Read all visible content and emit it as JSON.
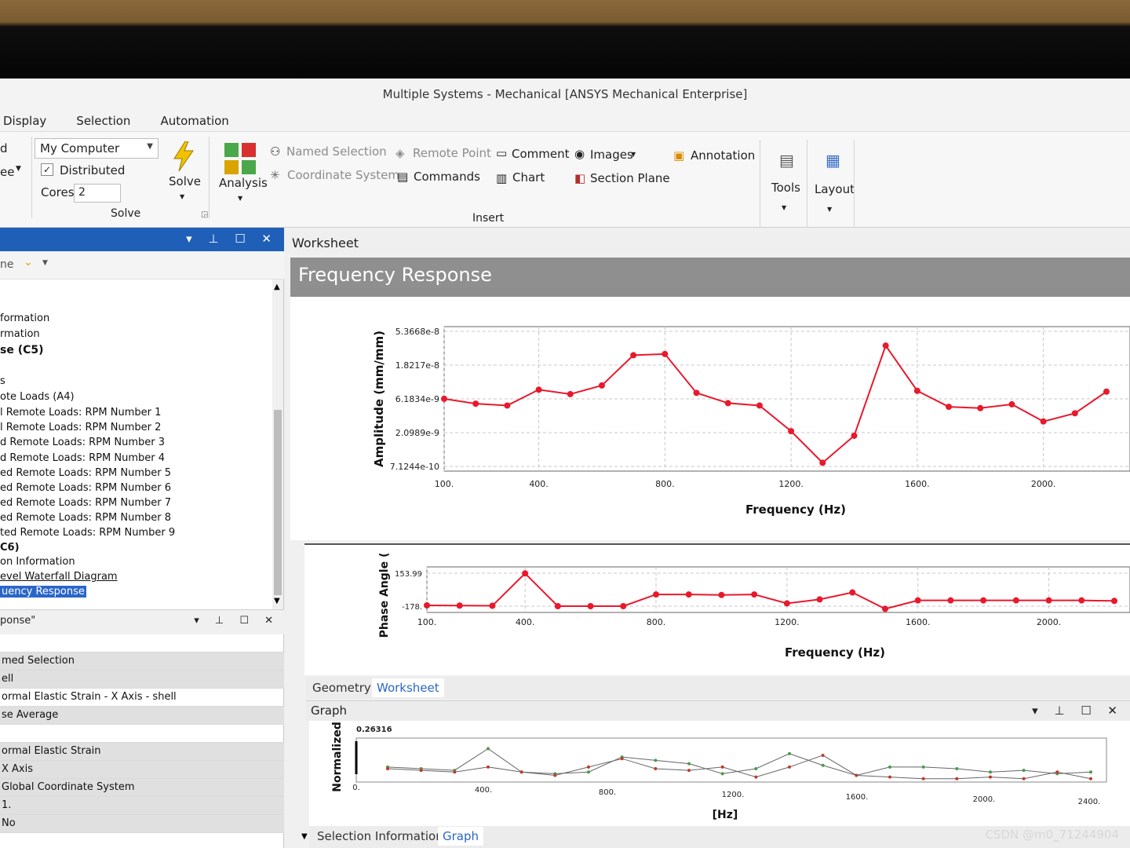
{
  "window": {
    "title": "Multiple Systems - Mechanical [ANSYS Mechanical Enterprise]"
  },
  "menu": [
    "Display",
    "Selection",
    "Automation"
  ],
  "ribbon": {
    "left_partial": [
      "d",
      "ee"
    ],
    "solve": {
      "computer": "My Computer",
      "distributed": "Distributed",
      "cores_label": "Cores",
      "cores_value": "2",
      "solve_label": "Solve",
      "group_label": "Solve"
    },
    "analysis_label": "Analysis",
    "insert": {
      "named_selection": "Named Selection",
      "coordinate_system": "Coordinate System",
      "remote_point": "Remote Point",
      "commands": "Commands",
      "comment": "Comment",
      "chart": "Chart",
      "images": "Images",
      "section_plane": "Section Plane",
      "annotation": "Annotation",
      "group_label": "Insert"
    },
    "tools_label": "Tools",
    "layout_label": "Layout"
  },
  "outline": {
    "toolbar_text": "ne",
    "items": [
      "formation",
      "rmation",
      "se (C5)",
      "s",
      "ote Loads (A4)",
      "l Remote Loads: RPM Number 1",
      "l Remote Loads: RPM Number 2",
      "d Remote Loads: RPM Number 3",
      "d Remote Loads: RPM Number 4",
      "ed Remote Loads: RPM Number 5",
      "ed Remote Loads: RPM Number 6",
      "ed Remote Loads: RPM Number 7",
      "ed Remote Loads: RPM Number 8",
      "ted Remote Loads: RPM Number 9",
      "C6)",
      "on Information",
      "evel Waterfall Diagram",
      "uency Response"
    ]
  },
  "details": {
    "header": "ponse\"",
    "rows": [
      "",
      "med Selection",
      "ell",
      "ormal Elastic Strain - X Axis - shell",
      "se Average",
      "",
      "ormal Elastic Strain",
      "X Axis",
      "Global Coordinate System",
      "1.",
      "No"
    ]
  },
  "worksheet": {
    "header": "Worksheet",
    "title": "Frequency Response"
  },
  "bottom_tabs": [
    "Geometry",
    "Worksheet"
  ],
  "graph": {
    "header": "Graph",
    "tabs": [
      "Selection Information",
      "Graph"
    ]
  },
  "colors": {
    "series": "#e8192c",
    "selection": "#2a66c8",
    "pane_header": "#1f5fb8"
  },
  "chart_data": [
    {
      "type": "line",
      "ylabel": "Amplitude (mm/mm)",
      "xlabel": "Frequency (Hz)",
      "x_ticks": [
        "100.",
        "400.",
        "800.",
        "1200.",
        "1600.",
        "2000."
      ],
      "y_ticks": [
        "5.3668e-8",
        "1.8217e-8",
        "6.1834e-9",
        "2.0989e-9",
        "7.1244e-10"
      ],
      "y_scale": "log",
      "x": [
        100,
        200,
        300,
        400,
        500,
        600,
        700,
        800,
        900,
        1000,
        1100,
        1200,
        1300,
        1400,
        1500,
        1600,
        1700,
        1800,
        1900,
        2000,
        2100,
        2200
      ],
      "y": [
        6.2e-09,
        5.3e-09,
        5e-09,
        8.3e-09,
        7.2e-09,
        9.5e-09,
        2.5e-08,
        2.6e-08,
        7.5e-09,
        5.4e-09,
        5e-09,
        2.2e-09,
        8e-10,
        1.9e-09,
        3.4e-08,
        8e-09,
        4.8e-09,
        4.6e-09,
        5.2e-09,
        3e-09,
        3.9e-09,
        7.8e-09
      ]
    },
    {
      "type": "line",
      "ylabel": "Phase Angle (",
      "xlabel": "Frequency (Hz)",
      "x_ticks": [
        "100.",
        "400.",
        "800.",
        "1200.",
        "1600.",
        "2000."
      ],
      "y_ticks": [
        "153.99",
        "-178."
      ],
      "ylim": [
        -178,
        153.99
      ],
      "x": [
        100,
        200,
        300,
        400,
        500,
        600,
        700,
        800,
        900,
        1000,
        1100,
        1200,
        1300,
        1400,
        1500,
        1600,
        1700,
        1800,
        1900,
        2000,
        2100,
        2200
      ],
      "y": [
        -170,
        -172,
        -174,
        152,
        -178,
        -178,
        -178,
        -60,
        -60,
        -65,
        -60,
        -150,
        -110,
        -40,
        -205,
        -120,
        -120,
        -120,
        -120,
        -120,
        -120,
        -125
      ]
    },
    {
      "type": "line",
      "ylabel": "Normalized",
      "xlabel": "[Hz]",
      "x_ticks": [
        "0.",
        "400.",
        "800.",
        "1200.",
        "1600.",
        "2000.",
        "2400."
      ],
      "y_ticks": [
        "0.26316"
      ],
      "series": [
        {
          "values": [
            0.09,
            0.08,
            0.07,
            0.2,
            0.06,
            0.05,
            0.06,
            0.15,
            0.13,
            0.11,
            0.05,
            0.08,
            0.17,
            0.1,
            0.04,
            0.09,
            0.09,
            0.08,
            0.06,
            0.07,
            0.05,
            0.06
          ]
        },
        {
          "values": [
            0.08,
            0.07,
            0.06,
            0.09,
            0.06,
            0.04,
            0.09,
            0.14,
            0.08,
            0.07,
            0.09,
            0.03,
            0.09,
            0.16,
            0.04,
            0.03,
            0.02,
            0.02,
            0.03,
            0.02,
            0.06,
            0.02
          ]
        }
      ]
    }
  ]
}
